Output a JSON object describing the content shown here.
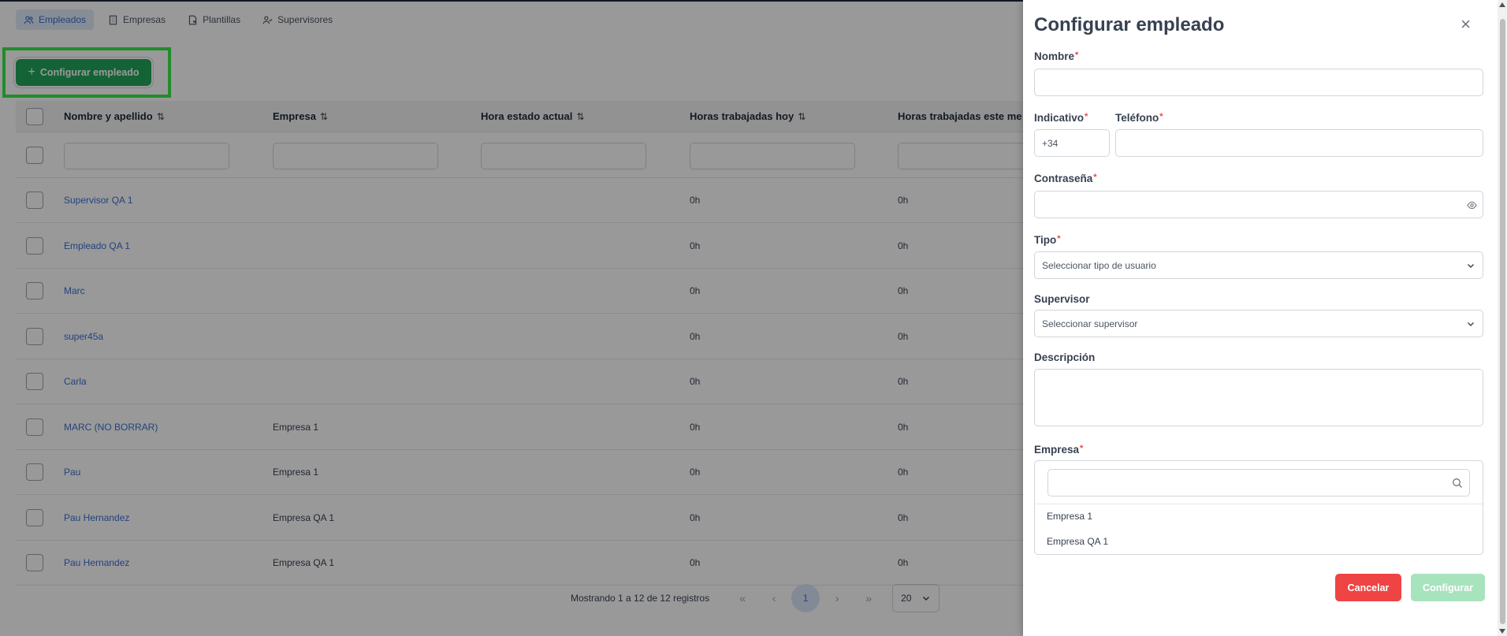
{
  "nav": {
    "tabs": [
      {
        "label": "Empleados",
        "icon": "users-icon",
        "active": true
      },
      {
        "label": "Empresas",
        "icon": "building-icon",
        "active": false
      },
      {
        "label": "Plantillas",
        "icon": "template-icon",
        "active": false
      },
      {
        "label": "Supervisores",
        "icon": "user-check-icon",
        "active": false
      }
    ]
  },
  "toolbar": {
    "configure_label": "Configurar empleado",
    "configure_icon": "plus-icon"
  },
  "table": {
    "columns": [
      "Nombre y apellido",
      "Empresa",
      "Hora estado actual",
      "Horas trabajadas hoy",
      "Horas trabajadas este me"
    ],
    "sort_icon": "sort-icon",
    "rows": [
      {
        "name": "Supervisor QA 1",
        "company": "",
        "state_time": "",
        "hours_today": "0h",
        "hours_month": "0h"
      },
      {
        "name": "Empleado QA 1",
        "company": "",
        "state_time": "",
        "hours_today": "0h",
        "hours_month": "0h"
      },
      {
        "name": "Marc",
        "company": "",
        "state_time": "",
        "hours_today": "0h",
        "hours_month": "0h"
      },
      {
        "name": "super45a",
        "company": "",
        "state_time": "",
        "hours_today": "0h",
        "hours_month": "0h"
      },
      {
        "name": "Carla",
        "company": "",
        "state_time": "",
        "hours_today": "0h",
        "hours_month": "0h"
      },
      {
        "name": "MARC (NO BORRAR)",
        "company": "Empresa 1",
        "state_time": "",
        "hours_today": "0h",
        "hours_month": "0h"
      },
      {
        "name": "Pau",
        "company": "Empresa 1",
        "state_time": "",
        "hours_today": "0h",
        "hours_month": "0h"
      },
      {
        "name": "Pau Hernandez",
        "company": "Empresa QA 1",
        "state_time": "",
        "hours_today": "0h",
        "hours_month": "0h"
      },
      {
        "name": "Pau Hernandez",
        "company": "Empresa QA 1",
        "state_time": "",
        "hours_today": "0h",
        "hours_month": "0h"
      }
    ]
  },
  "pagination": {
    "info": "Mostrando 1 a 12 de 12 registros",
    "first": "«",
    "prev": "‹",
    "current_page": "1",
    "next": "›",
    "last": "»",
    "page_size": "20"
  },
  "panel": {
    "title": "Configurar empleado",
    "close_icon": "close-icon",
    "required_mark": "*",
    "fields": {
      "nombre": {
        "label": "Nombre",
        "value": ""
      },
      "indicativo": {
        "label": "Indicativo",
        "value": "+34"
      },
      "telefono": {
        "label": "Teléfono",
        "value": ""
      },
      "password": {
        "label": "Contraseña",
        "value": ""
      },
      "tipo": {
        "label": "Tipo",
        "placeholder": "Seleccionar tipo de usuario"
      },
      "supervisor": {
        "label": "Supervisor",
        "placeholder": "Seleccionar supervisor"
      },
      "descripcion": {
        "label": "Descripción",
        "value": ""
      },
      "empresa": {
        "label": "Empresa",
        "search_value": "",
        "options": [
          "Empresa 1",
          "Empresa QA 1"
        ]
      }
    },
    "cancel_label": "Cancelar",
    "submit_label": "Configurar"
  },
  "colors": {
    "primary": "#22a55a",
    "link": "#3b6fd3",
    "danger": "#ef4444",
    "highlight": "#39e84a",
    "disabled_submit": "#a7e3bd"
  }
}
